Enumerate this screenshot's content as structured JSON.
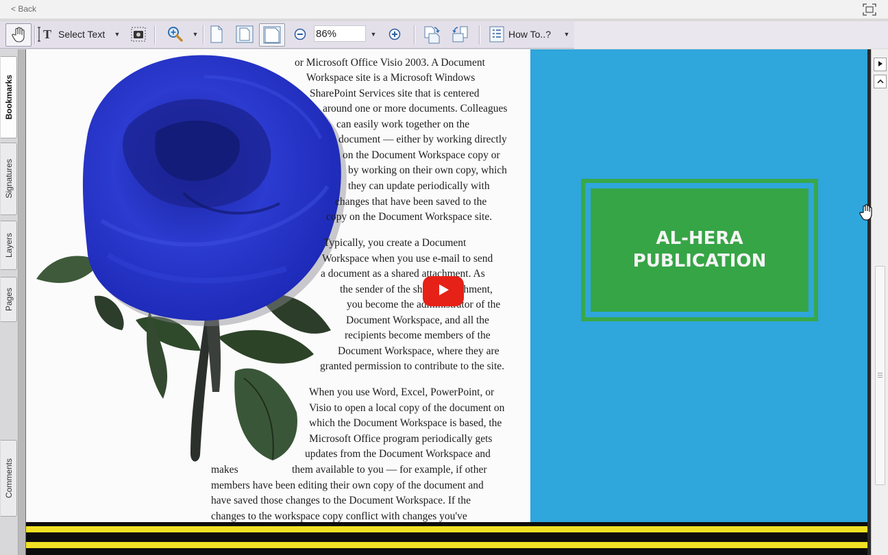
{
  "topbar": {
    "back_label": "< Back"
  },
  "toolbar": {
    "select_text_label": "Select Text",
    "zoom_value": "86%",
    "how_to_label": "How To..?"
  },
  "sidebar": {
    "tabs": [
      {
        "label": "Bookmarks",
        "active": true
      },
      {
        "label": "Signatures",
        "active": false
      },
      {
        "label": "Layers",
        "active": false
      },
      {
        "label": "Pages",
        "active": false
      },
      {
        "label": "Comments",
        "active": false
      }
    ]
  },
  "document": {
    "lines": [
      "or Microsoft Office Visio 2003. A Document",
      "Workspace site is a Microsoft Windows",
      "SharePoint Services site that is centered",
      "around one or more documents. Colleagues",
      "can easily work together on the",
      "document — either by working directly",
      "on the Document Workspace copy or",
      "by working on their own copy, which",
      "they can update periodically with",
      "changes that have been saved to the",
      "copy on the Document Workspace site.",
      "Typically, you create a Document",
      "Workspace when you use e-mail to send",
      "a document as a shared attachment. As",
      "the sender of the shared attachment,",
      "you become the administrator of the",
      "Document Workspace, and all the",
      "recipients become members of the",
      "Document Workspace, where they are",
      "granted permission to contribute to the site.",
      "When you use Word, Excel, PowerPoint, or",
      "Visio to open a local copy of the document on",
      "which the Document Workspace is based, the",
      "Microsoft Office program periodically gets",
      "updates from the Document Workspace and",
      "makes",
      "them available to you — for example, if other",
      "members have been editing their own copy of the document and",
      "have saved those changes to the Document Workspace. If the",
      "changes to the workspace copy conflict with changes you've"
    ]
  },
  "publisher": {
    "line1": "AL-HERA",
    "line2": "PUBLICATION"
  },
  "colors": {
    "page_right_bg": "#2fa6dc",
    "logo_green": "#36a546",
    "play_red": "#e62117",
    "stripe_yellow": "#f0e024"
  }
}
